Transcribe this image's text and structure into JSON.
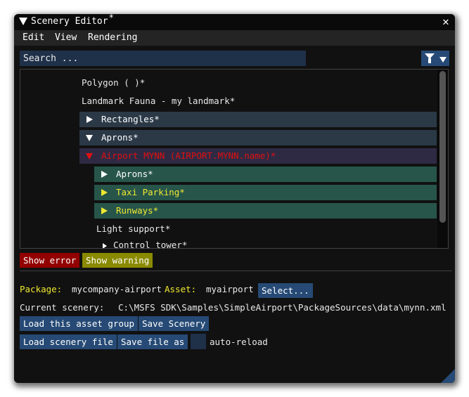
{
  "window": {
    "title": "Scenery Editor",
    "title_modified_marker": "*",
    "close_glyph": "✕"
  },
  "menu": {
    "items": [
      "Edit",
      "View",
      "Rendering"
    ]
  },
  "search": {
    "placeholder": "Search ..."
  },
  "filter": {
    "icon": "filter-icon",
    "dropdown_icon": "caret-down-icon"
  },
  "tree": {
    "nodes": [
      {
        "label": "Polygon  ( )*",
        "expanded": null,
        "style": "plain"
      },
      {
        "label": "Landmark Fauna - my landmark*",
        "expanded": null,
        "style": "plain"
      },
      {
        "label": "Rectangles*",
        "expanded": false,
        "style": "slate"
      },
      {
        "label": "Aprons*",
        "expanded": true,
        "style": "slate"
      },
      {
        "label": "Airport MYNN (AIRPORT.MYNN.name)*",
        "expanded": true,
        "style": "selected-error"
      },
      {
        "label": "Aprons*",
        "expanded": false,
        "style": "green"
      },
      {
        "label": "Taxi Parking*",
        "expanded": false,
        "style": "green-warning"
      },
      {
        "label": "Runways*",
        "expanded": false,
        "style": "green-warning"
      },
      {
        "label": "Light support*",
        "expanded": null,
        "style": "plain"
      },
      {
        "label": "Control tower*",
        "expanded": false,
        "style": "plain-small"
      }
    ]
  },
  "status_buttons": {
    "error": "Show error",
    "warning": "Show warning"
  },
  "info": {
    "package_label": "Package:",
    "package_value": "mycompany-airport",
    "asset_label": "Asset:",
    "asset_value": "myairport",
    "select_button": "Select...",
    "current_scenery_label": "Current scenery:",
    "current_scenery_path": "C:\\MSFS SDK\\Samples\\SimpleAirport\\PackageSources\\data\\mynn.xml"
  },
  "actions": {
    "load_asset_group": "Load this asset group",
    "save_scenery": "Save Scenery",
    "load_scenery_file": "Load scenery file",
    "save_file_as": "Save file as",
    "auto_reload_label": "auto-reload",
    "auto_reload_checked": false
  },
  "colors": {
    "window_bg": "#111111",
    "accent_blue": "#264a75",
    "error_red": "#930000",
    "warning_olive": "#8a8a00",
    "error_text": "#e01010",
    "warning_text": "#f0e830",
    "label_yellow": "#f0e830"
  }
}
